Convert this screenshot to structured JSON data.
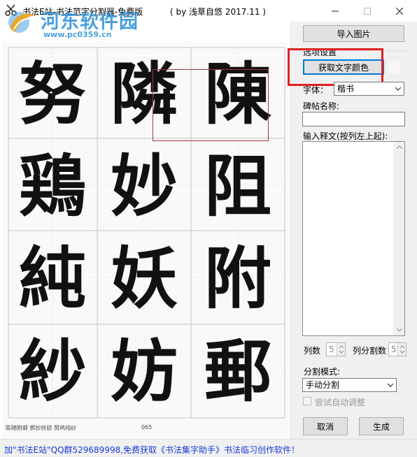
{
  "window": {
    "title": "书法E站-书法范字分割器-免费版",
    "byline": "( by 浅草自悠    2017.11 )"
  },
  "watermark": {
    "site_name": "河东软件园",
    "url": "www.pc0359.cn"
  },
  "sheet": {
    "characters": [
      "努",
      "隣",
      "陳",
      "鶏",
      "妙",
      "阻",
      "純",
      "妖",
      "附",
      "紗",
      "妨",
      "郵"
    ],
    "footer_caption": "陈随附邮 郭妙妖妨 努鸡纯纱",
    "page_number": "065"
  },
  "panel": {
    "import_button": "导入图片",
    "options_group": "选项设置",
    "get_color_button": "获取文字颜色",
    "font_label": "字体：",
    "font_value": "楷书",
    "stele_label": "碑帖名称:",
    "stele_value": "",
    "transcript_label": "输入释文(按列左上起):",
    "transcript_value": "",
    "columns_label": "列数",
    "columns_value": "5",
    "col_split_label": "列分割数",
    "col_split_value": "5",
    "mode_label": "分割模式:",
    "mode_value": "手动分割",
    "auto_adjust_label": "尝试自动调整",
    "cancel_button": "取消",
    "generate_button": "生成"
  },
  "status": {
    "text": "加\"书法E站\"QQ群529689998,免费获取《书法集字助手》书法临习创作软件！"
  },
  "colors": {
    "highlight_box": "#e02020",
    "selection_rect": "#a3393c",
    "status_link": "#1a3cd8",
    "watermark": "#2a8fd8"
  }
}
